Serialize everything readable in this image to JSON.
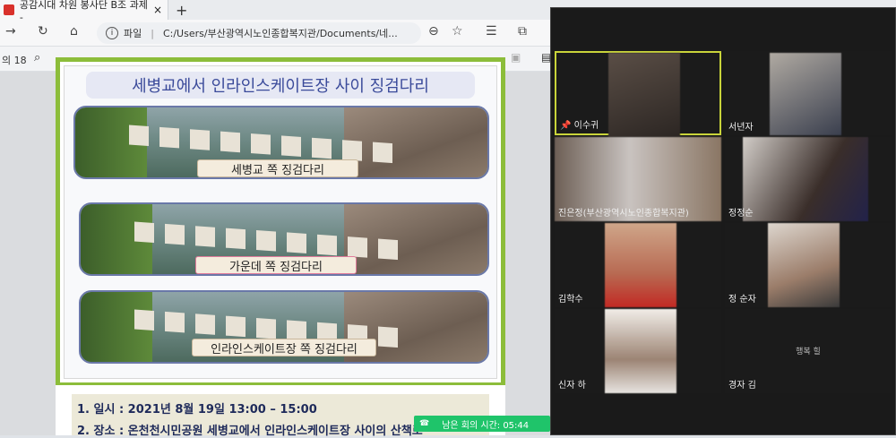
{
  "browser": {
    "tab_title": "공감시대 차원 봉사단 B조 과제 -",
    "tab_close": "×",
    "new_tab": "+",
    "url_prefix": "파일",
    "url": "C:/Users/부산광역시노인종합복지관/Documents/네...",
    "page_indicator": "의 18"
  },
  "slide": {
    "title": "세병교에서 인라인스케이트장 사이 징검다리",
    "captions": [
      "세병교 쪽 징검다리",
      "가운데 쪽 징검다리",
      "인라인스케이트장 쪽 징검다리"
    ],
    "info_line_1": "1.   일시 : 2021년 8월 19일 13:00 – 15:00",
    "info_line_2": "2.   장소 : 온천천시민공원 세병교에서 인라인스케이트장 사이의 산책로"
  },
  "meeting": {
    "timer_icon": "☎",
    "timer_text": "남은 회의 시간: 05:44",
    "participants": [
      {
        "name": "이수귀",
        "pinned": true
      },
      {
        "name": "서년자"
      },
      {
        "name": "진은정(부산광역시노인종합복지관)"
      },
      {
        "name": "정정순"
      },
      {
        "name": "김학수"
      },
      {
        "name": "정 순자"
      },
      {
        "name": "신자 하"
      },
      {
        "name": "경자 김",
        "center_text": "행복 힐"
      }
    ]
  }
}
